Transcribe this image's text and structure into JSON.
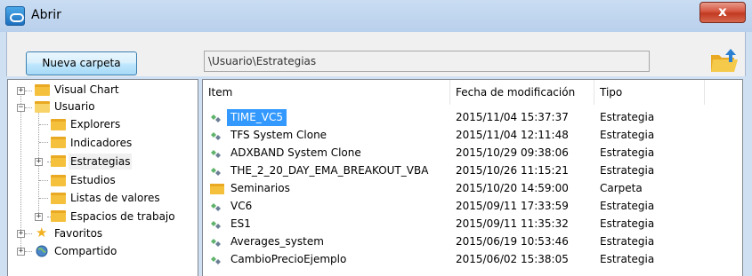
{
  "window": {
    "title": "Abrir",
    "close_label": "x"
  },
  "toolbar": {
    "new_folder_label": "Nueva carpeta",
    "path": "\\Usuario\\Estrategias"
  },
  "tree": {
    "items": [
      {
        "label": "Visual Chart",
        "icon": "folder-icon"
      },
      {
        "label": "Usuario",
        "icon": "folder-open-icon"
      },
      {
        "label": "Explorers",
        "icon": "folder-icon"
      },
      {
        "label": "Indicadores",
        "icon": "folder-icon"
      },
      {
        "label": "Estrategias",
        "icon": "folder-icon"
      },
      {
        "label": "Estudios",
        "icon": "folder-icon"
      },
      {
        "label": "Listas de valores",
        "icon": "folder-icon"
      },
      {
        "label": "Espacios de trabajo",
        "icon": "folder-icon"
      },
      {
        "label": "Favoritos",
        "icon": "star-icon"
      },
      {
        "label": "Compartido",
        "icon": "globe-icon"
      }
    ]
  },
  "list": {
    "headers": [
      "Item",
      "Fecha de modificación",
      "Tipo"
    ],
    "rows": [
      {
        "name": "TIME_VC5",
        "date": "2015/11/04 15:37:37",
        "type": "Estrategia",
        "icon": "strategy-icon"
      },
      {
        "name": "TFS System Clone",
        "date": "2015/11/04 12:11:48",
        "type": "Estrategia",
        "icon": "strategy-icon"
      },
      {
        "name": "ADXBAND System Clone",
        "date": "2015/10/29 09:38:06",
        "type": "Estrategia",
        "icon": "strategy-icon"
      },
      {
        "name": "THE_2_20_DAY_EMA_BREAKOUT_VBA",
        "date": "2015/10/26 11:15:21",
        "type": "Estrategia",
        "icon": "strategy-icon"
      },
      {
        "name": "Seminarios",
        "date": "2015/10/20 14:59:00",
        "type": "Carpeta",
        "icon": "folder-icon"
      },
      {
        "name": "VC6",
        "date": "2015/09/11 17:33:59",
        "type": "Estrategia",
        "icon": "strategy-icon"
      },
      {
        "name": "ES1",
        "date": "2015/09/11 11:35:32",
        "type": "Estrategia",
        "icon": "strategy-icon"
      },
      {
        "name": "Averages_system",
        "date": "2015/06/19 10:53:46",
        "type": "Estrategia",
        "icon": "strategy-icon"
      },
      {
        "name": "CambioPrecioEjemplo",
        "date": "2015/06/02 15:38:05",
        "type": "Estrategia",
        "icon": "strategy-icon"
      }
    ]
  },
  "colors": {
    "selection": "#3399ff",
    "folder": "#f5c03b",
    "title_bar": "#c9dcf2"
  }
}
